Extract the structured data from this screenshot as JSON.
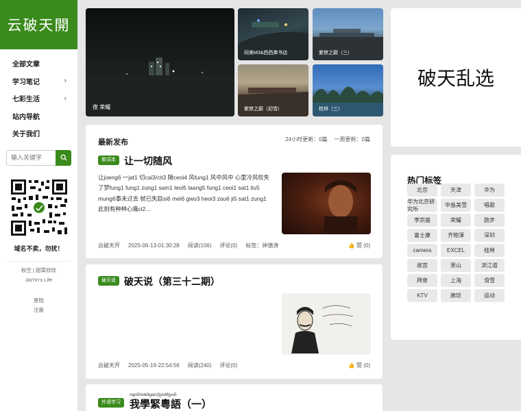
{
  "logo": "云破天開",
  "nav": [
    {
      "label": "全部文章",
      "has_sub": false
    },
    {
      "label": "学习笔记",
      "has_sub": true
    },
    {
      "label": "七彩生活",
      "has_sub": true
    },
    {
      "label": "站内导航",
      "has_sub": false
    },
    {
      "label": "关于我们",
      "has_sub": false
    }
  ],
  "search": {
    "placeholder": "输入关键字"
  },
  "qr_slogan": "域名不卖，勿扰！",
  "footer": {
    "line1": "秋空 | 甜菜欣欣",
    "line2": "JiaYin's Life",
    "login": "登陆",
    "register": "注册"
  },
  "gallery": [
    {
      "caption": "夜 荣耀"
    },
    {
      "caption": "同美M3&西西弗书店"
    },
    {
      "caption": "紫禁之巅（三）"
    },
    {
      "caption": "紫禁之巅（初雪）"
    },
    {
      "caption": "桂林（三）"
    }
  ],
  "feed": {
    "heading": "最新发布",
    "counts": [
      "24小时更新：0篇",
      "一周更新：0篇"
    ]
  },
  "posts": [
    {
      "category": "歌词本",
      "title": "让一切随风",
      "excerpt": "让joeng6 一jat1 切cai3/cit3 随ceoi4 风fung1 风中风中 心里冷风吹失了梦fung1 fung1 zung1 sam1 leoi5 laang5 fung1 ceoi1 sat1 liu5 mung6事未过去 就已失踪si6 mei6 gwo3 heoi3 zau6 ji5 sat1 zung1此刻有种种心痛ci2...",
      "author": "云破天开",
      "date": "2025-06-13-01:30:28",
      "reads": "阅读(106)",
      "comments": "评论(0)",
      "tags": "标签：钟镇涛",
      "likes": "赞 (0)"
    },
    {
      "category": "破天说",
      "title": "破天说（第三十二期）",
      "author": "云破天开",
      "date": "2025-05-19-22:54:56",
      "reads": "阅读(240)",
      "comments": "评论(0)",
      "likes": "赞 (0)"
    },
    {
      "category": "外语学习",
      "ruby": "ngo5hok6gan2jyut6jyu5",
      "title": "我學緊粵語（一）"
    }
  ],
  "banner": "破天乱选",
  "hot_tags": {
    "title": "热门标签",
    "items": [
      "北京",
      "天津",
      "华为",
      "华为北京研究所",
      "中島美雪",
      "唱歌",
      "李宗盛",
      "荣耀",
      "跑步",
      "富士康",
      "齐物渾",
      "深圳",
      "camera",
      "EXCEL",
      "桂林",
      "故宫",
      "景山",
      "滨江道",
      "拜泉",
      "上海",
      "滑雪",
      "KTV",
      "廊坊",
      "运动"
    ]
  },
  "colors": {
    "accent": "#3a8a1c",
    "page_bg": "#e6e6e6"
  }
}
